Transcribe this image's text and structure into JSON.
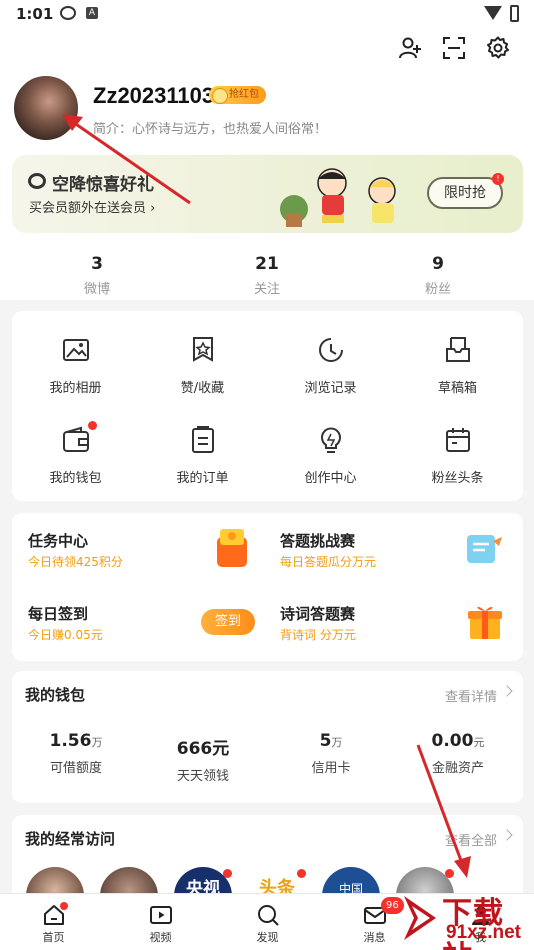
{
  "status_bar": {
    "time": "1:01",
    "a_label": "A"
  },
  "profile": {
    "username": "Zz20231103",
    "badge": "抢红包",
    "intro": "简介：心怀诗与远方，也热爱人间俗常！"
  },
  "vip_banner": {
    "title": "空降惊喜好礼",
    "subtitle": "买会员额外在送会员 ›",
    "button": "限时抢",
    "dot": "!"
  },
  "stats": [
    {
      "value": "3",
      "label": "微博"
    },
    {
      "value": "21",
      "label": "关注"
    },
    {
      "value": "9",
      "label": "粉丝"
    }
  ],
  "grid": [
    {
      "label": "我的相册",
      "icon": "photo-album-icon"
    },
    {
      "label": "赞/收藏",
      "icon": "favorite-icon"
    },
    {
      "label": "浏览记录",
      "icon": "history-icon"
    },
    {
      "label": "草稿箱",
      "icon": "draft-box-icon"
    },
    {
      "label": "我的钱包",
      "icon": "wallet-icon"
    },
    {
      "label": "我的订单",
      "icon": "order-icon"
    },
    {
      "label": "创作中心",
      "icon": "lightbulb-icon"
    },
    {
      "label": "粉丝头条",
      "icon": "calendar-icon"
    }
  ],
  "tasks": [
    {
      "title": "任务中心",
      "subtitle": "今日待领425积分"
    },
    {
      "title": "答题挑战赛",
      "subtitle": "每日答题瓜分万元"
    },
    {
      "title": "每日签到",
      "subtitle": "今日赚0.05元",
      "button": "签到"
    },
    {
      "title": "诗词答题赛",
      "subtitle": "背诗词 分万元"
    }
  ],
  "wallet": {
    "title": "我的钱包",
    "link": "查看详情",
    "items": [
      {
        "num": "1.56",
        "unit": "万",
        "label": "可借额度"
      },
      {
        "num": "666元",
        "unit": "",
        "label": "天天领钱"
      },
      {
        "num": "5",
        "unit": "万",
        "label": "信用卡"
      },
      {
        "num": "0.00",
        "unit": "元",
        "label": "金融资产"
      }
    ]
  },
  "frequent": {
    "title": "我的经常访问",
    "link": "查看全部",
    "avatar_texts": [
      "央视",
      "头条",
      "中国"
    ]
  },
  "tabbar": [
    {
      "label": "首页",
      "icon": "home-icon"
    },
    {
      "label": "视频",
      "icon": "video-icon"
    },
    {
      "label": "发现",
      "icon": "discover-icon"
    },
    {
      "label": "消息",
      "icon": "message-icon",
      "badge": "96"
    },
    {
      "label": "我",
      "icon": "profile-icon"
    }
  ],
  "watermark": {
    "big": "下载站",
    "small": "91xz.net"
  },
  "colors": {
    "accent": "#f39c12",
    "red": "#f3322b",
    "arrow": "#d6282b"
  }
}
